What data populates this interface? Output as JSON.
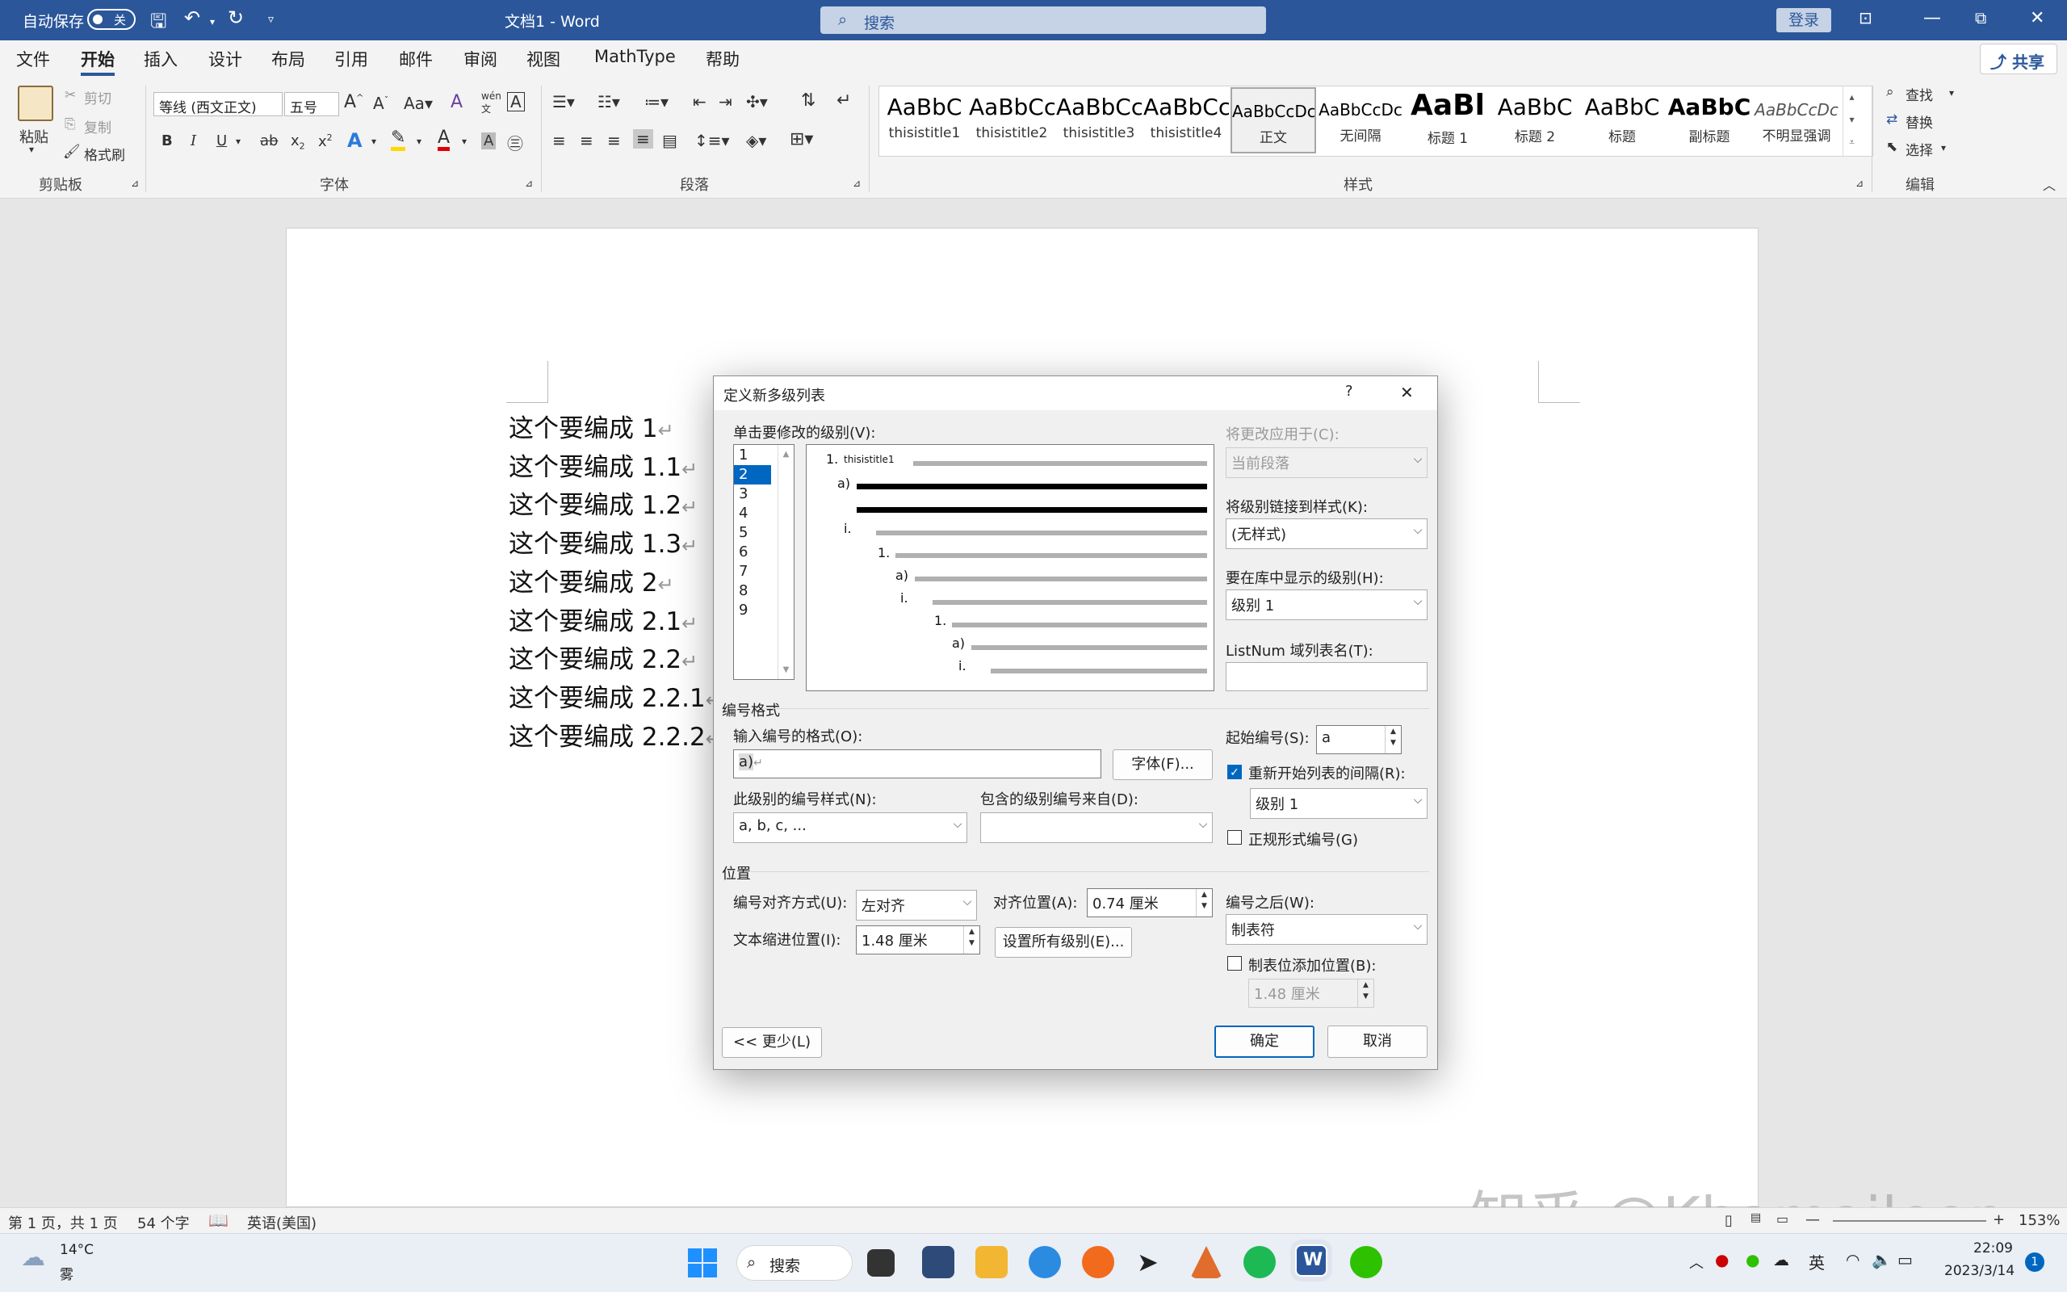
{
  "titlebar": {
    "autosave_label": "自动保存",
    "autosave_state": "关",
    "doc_title": "文档1 - Word",
    "search_placeholder": "搜索",
    "login_label": "登录"
  },
  "tabs": [
    "文件",
    "开始",
    "插入",
    "设计",
    "布局",
    "引用",
    "邮件",
    "审阅",
    "视图",
    "MathType",
    "帮助"
  ],
  "active_tab": "开始",
  "share_label": "共享",
  "ribbon": {
    "clipboard": {
      "paste": "粘贴",
      "cut": "剪切",
      "copy": "复制",
      "format_painter": "格式刷",
      "group": "剪贴板"
    },
    "font": {
      "name": "等线 (西文正文)",
      "size": "五号",
      "group": "字体"
    },
    "paragraph": {
      "group": "段落"
    },
    "styles": {
      "group": "样式",
      "items": [
        {
          "preview": "AaBbC",
          "name": "thisistitle1"
        },
        {
          "preview": "AaBbCc",
          "name": "thisistitle2"
        },
        {
          "preview": "AaBbCcI",
          "name": "thisistitle3"
        },
        {
          "preview": "AaBbCcD",
          "name": "thisistitle4"
        },
        {
          "preview": "AaBbCcDc",
          "name": "正文"
        },
        {
          "preview": "AaBbCcDc",
          "name": "无间隔"
        },
        {
          "preview": "AaBl",
          "name": "标题 1"
        },
        {
          "preview": "AaBbC",
          "name": "标题 2"
        },
        {
          "preview": "AaBbC",
          "name": "标题"
        },
        {
          "preview": "AaBbC",
          "name": "副标题"
        },
        {
          "preview": "AaBbCcDc",
          "name": "不明显强调"
        }
      ]
    },
    "editing": {
      "find": "查找",
      "replace": "替换",
      "select": "选择",
      "group": "编辑"
    }
  },
  "document": {
    "lines": [
      "这个要编成 1",
      "这个要编成 1.1",
      "这个要编成 1.2",
      "这个要编成 1.3",
      "这个要编成 2",
      "这个要编成 2.1",
      "这个要编成 2.2",
      "这个要编成 2.2.1",
      "这个要编成 2.2.2"
    ]
  },
  "dialog": {
    "title": "定义新多级列表",
    "help": "?",
    "close": "✕",
    "level_label": "单击要修改的级别(V):",
    "levels": [
      "1",
      "2",
      "3",
      "4",
      "5",
      "6",
      "7",
      "8",
      "9"
    ],
    "selected_level": "2",
    "preview": {
      "l1": "1.",
      "l1_text": "thisistitle1",
      "l2": "a)",
      "l3": "i.",
      "l4": "1.",
      "l5": "a)",
      "l6": "i.",
      "l7": "1.",
      "l8": "a)",
      "l9": "i."
    },
    "apply_to_label": "将更改应用于(C):",
    "apply_to_value": "当前段落",
    "link_style_label": "将级别链接到样式(K):",
    "link_style_value": "(无样式)",
    "gallery_level_label": "要在库中显示的级别(H):",
    "gallery_level_value": "级别 1",
    "listnum_label": "ListNum 域列表名(T):",
    "listnum_value": "",
    "number_format_section": "编号格式",
    "enter_format_label": "输入编号的格式(O):",
    "enter_format_value": "a)",
    "font_button": "字体(F)...",
    "number_style_label": "此级别的编号样式(N):",
    "number_style_value": "a, b, c, ...",
    "include_level_label": "包含的级别编号来自(D):",
    "include_level_value": "",
    "start_at_label": "起始编号(S):",
    "start_at_value": "a",
    "restart_label": "重新开始列表的间隔(R):",
    "restart_checked": true,
    "restart_value": "级别 1",
    "legal_label": "正规形式编号(G)",
    "legal_checked": false,
    "position_section": "位置",
    "alignment_label": "编号对齐方式(U):",
    "alignment_value": "左对齐",
    "aligned_at_label": "对齐位置(A):",
    "aligned_at_value": "0.74 厘米",
    "text_indent_label": "文本缩进位置(I):",
    "text_indent_value": "1.48 厘米",
    "set_all_button": "设置所有级别(E)...",
    "follow_with_label": "编号之后(W):",
    "follow_with_value": "制表符",
    "tab_stop_label": "制表位添加位置(B):",
    "tab_stop_checked": false,
    "tab_stop_value": "1.48 厘米",
    "less_button": "<< 更少(L)",
    "ok_button": "确定",
    "cancel_button": "取消"
  },
  "statusbar": {
    "page": "第 1 页，共 1 页",
    "words": "54 个字",
    "language": "英语(美国)",
    "zoom": "153%"
  },
  "taskbar": {
    "weather_temp": "14°C",
    "weather_desc": "雾",
    "search_label": "搜索",
    "ime": "英",
    "time": "22:09",
    "date": "2023/3/14",
    "notification_count": "1"
  },
  "watermark": "知乎 @Khamaileon",
  "colors": {
    "accent": "#2b579a",
    "dialog_accent": "#0067c0"
  }
}
